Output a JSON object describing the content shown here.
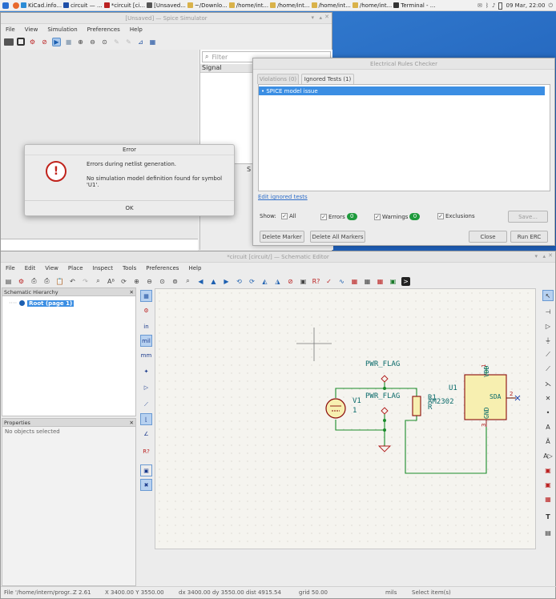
{
  "taskbar": {
    "tasks": [
      "KiCad.info...",
      "circuit — ...",
      "*circuit [ci...",
      "[Unsaved...",
      "~/Downlo...",
      "/home/int...",
      "/home/int...",
      "/home/int...",
      "/home/int...",
      "Terminal - ..."
    ],
    "clock": "09 Mar, 22:00"
  },
  "spice": {
    "title": "[Unsaved] — Spice Simulator",
    "menu": [
      "File",
      "View",
      "Simulation",
      "Preferences",
      "Help"
    ],
    "filter_placeholder": "Filter",
    "signal_header": "Signal",
    "side_letter": "S"
  },
  "error_dialog": {
    "title": "Error",
    "line1": "Errors during netlist generation.",
    "line2": "No simulation model definition found for symbol 'U1'.",
    "ok": "OK"
  },
  "erc": {
    "title": "Electrical Rules Checker",
    "tab_violations": "Violations (0)",
    "tab_ignored": "Ignored Tests (1)",
    "selected_item": "• SPICE model issue",
    "edit_ignored": "Edit ignored tests",
    "show_label": "Show:",
    "all": "All",
    "errors": "Errors",
    "errors_count": "0",
    "warnings": "Warnings",
    "warnings_count": "0",
    "exclusions": "Exclusions",
    "save": "Save...",
    "delete_marker": "Delete Marker",
    "delete_all": "Delete All Markers",
    "close": "Close",
    "run": "Run ERC"
  },
  "sch": {
    "title": "*circuit [circuit/] — Schematic Editor",
    "menu": [
      "File",
      "Edit",
      "View",
      "Place",
      "Inspect",
      "Tools",
      "Preferences",
      "Help"
    ],
    "hierarchy_title": "Schematic Hierarchy",
    "root": "Root (page 1)",
    "properties_title": "Properties",
    "no_objects": "No objects selected",
    "left_tools": {
      "in": "in",
      "mil": "mil",
      "mm": "mm"
    },
    "labels": {
      "pwr_flag_1": "PWR_FLAG",
      "pwr_flag_2": "PWR_FLAG",
      "v1": "V1",
      "v1_val": "1",
      "r1": "R1",
      "r1_val": "R",
      "u1": "U1",
      "u1_val": "AM2302",
      "vdd": "VDD",
      "gnd": "GND",
      "sda": "SDA",
      "pin1": "1",
      "pin2": "2",
      "pin3": "3"
    }
  },
  "status": {
    "file": "File '/home/intern/progr...",
    "z": "Z 2.61",
    "xy": "X 3400.00  Y 3550.00",
    "dxy": "dx 3400.00  dy 3550.00  dist 4915.54",
    "grid": "grid 50.00",
    "units": "mils",
    "mode": "Select item(s)"
  },
  "colors": {
    "wire": "#1a8c2a",
    "symbol_body": "#f7efb0",
    "symbol_outline": "#8a0a0a",
    "pin_text": "#0a6a6a",
    "selection": "#3b8ee3"
  }
}
